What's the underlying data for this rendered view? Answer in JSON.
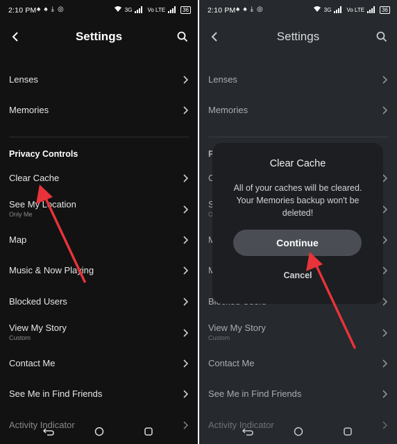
{
  "status_bar": {
    "time": "2:10 PM",
    "network_labels": [
      "3G",
      "Vo LTE",
      "3G",
      "Vo LTE"
    ],
    "battery": "36"
  },
  "header": {
    "title": "Settings",
    "back_icon": "chevron-left-icon",
    "search_icon": "search-icon"
  },
  "settings": {
    "lenses": "Lenses",
    "memories": "Memories",
    "privacy_section": "Privacy Controls",
    "clear_cache": "Clear Cache",
    "see_my_location": "See My Location",
    "see_my_location_sub": "Only Me",
    "map": "Map",
    "music": "Music & Now Playing",
    "blocked_users": "Blocked Users",
    "view_my_story": "View My Story",
    "view_my_story_sub": "Custom",
    "contact_me": "Contact Me",
    "see_me_find_friends": "See Me in Find Friends",
    "activity_indicator": "Activity Indicator"
  },
  "dialog": {
    "title": "Clear Cache",
    "message": "All of your caches will be cleared. Your Memories backup won't be deleted!",
    "continue_label": "Continue",
    "cancel_label": "Cancel"
  },
  "colors": {
    "left_bg": "#121212",
    "right_bg": "#26292d",
    "arrow": "#e8333a",
    "dialog_bg": "#1c1e21",
    "button_bg": "#4a4e54"
  }
}
